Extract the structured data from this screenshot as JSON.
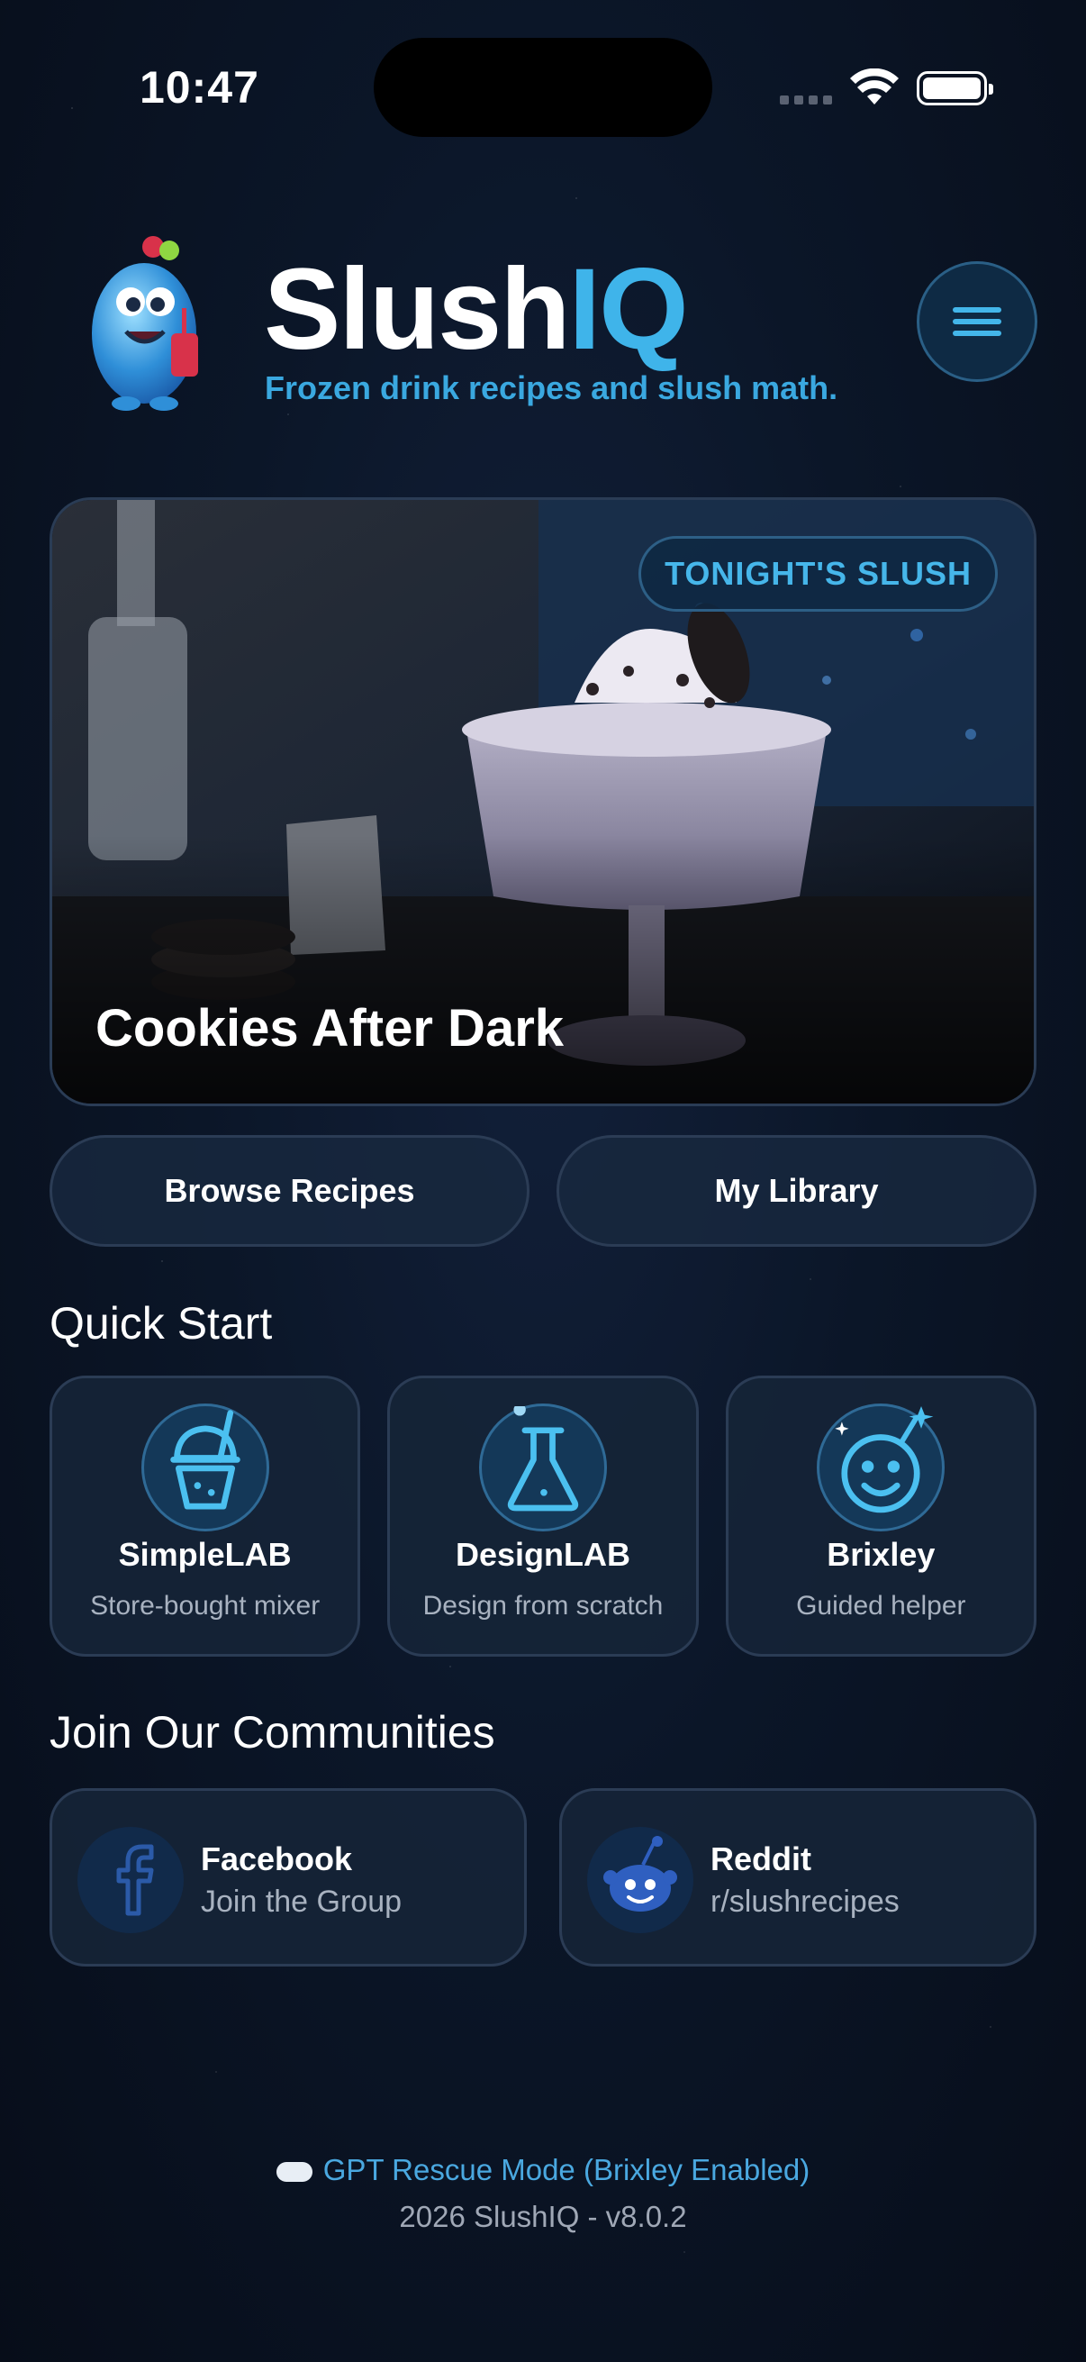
{
  "status_bar": {
    "time": "10:47"
  },
  "header": {
    "brand_main": "Slush",
    "brand_accent": "IQ",
    "tagline": "Frozen drink recipes and slush math."
  },
  "hero": {
    "badge": "TONIGHT'S SLUSH",
    "title": "Cookies After Dark"
  },
  "actions": {
    "browse": "Browse Recipes",
    "library": "My Library"
  },
  "quick_start": {
    "title": "Quick Start",
    "items": [
      {
        "label": "SimpleLAB",
        "sub": "Store-bought mixer",
        "icon": "slush-cup-icon"
      },
      {
        "label": "DesignLAB",
        "sub": "Design from scratch",
        "icon": "flask-icon"
      },
      {
        "label": "Brixley",
        "sub": "Guided helper",
        "icon": "brixley-face-icon"
      }
    ]
  },
  "communities": {
    "title": "Join Our Communities",
    "items": [
      {
        "title": "Facebook",
        "sub": "Join the Group",
        "icon": "facebook-icon"
      },
      {
        "title": "Reddit",
        "sub": "r/slushrecipes",
        "icon": "reddit-icon"
      }
    ]
  },
  "footer": {
    "rescue_mode": "GPT Rescue Mode (Brixley Enabled)",
    "version": "2026 SlushIQ - v8.0.2"
  },
  "colors": {
    "accent": "#3fb4ea",
    "background": "#0b1628",
    "card": "#16243a"
  }
}
